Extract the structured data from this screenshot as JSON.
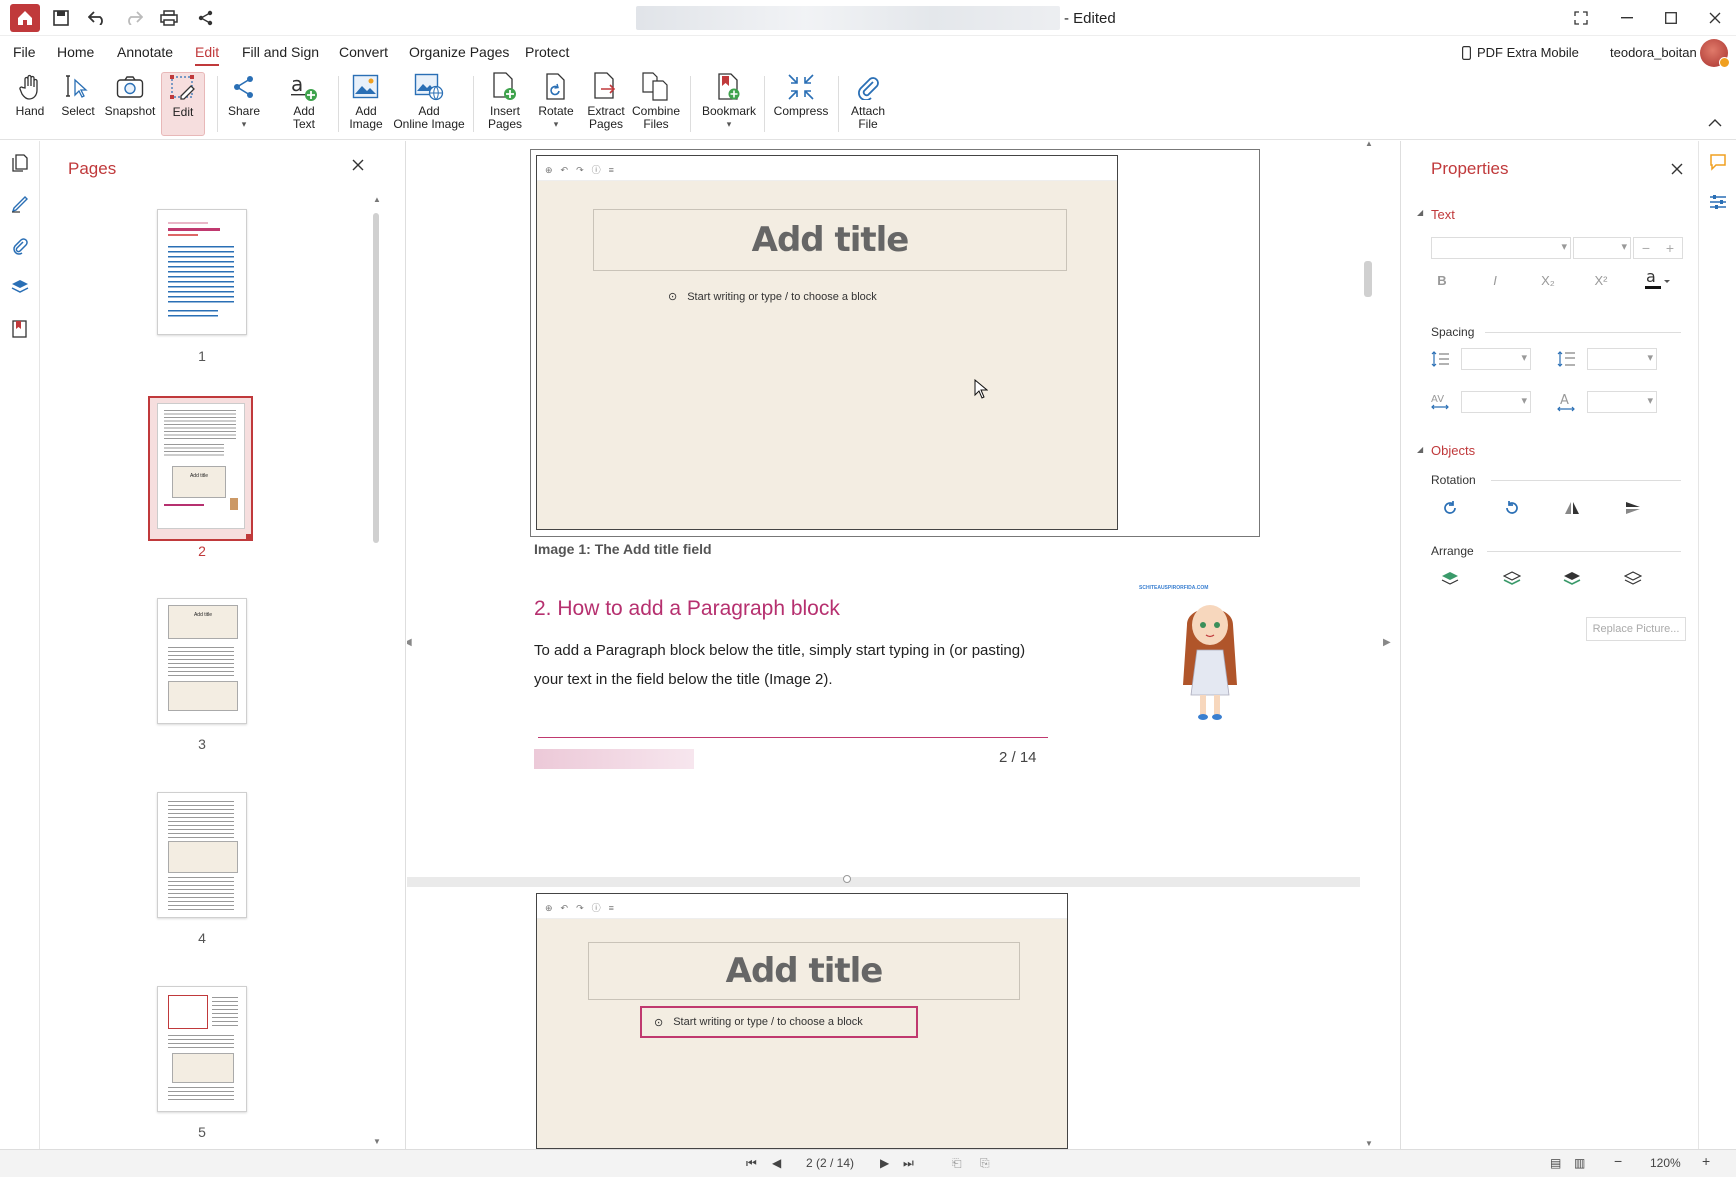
{
  "window": {
    "title_suffix": "- Edited",
    "user": "teodora_boitan",
    "mobile_label": "PDF Extra Mobile"
  },
  "menu": [
    "File",
    "Home",
    "Annotate",
    "Edit",
    "Fill and Sign",
    "Convert",
    "Organize Pages",
    "Protect"
  ],
  "ribbon": {
    "hand": "Hand",
    "select": "Select",
    "snapshot": "Snapshot",
    "edit": "Edit",
    "share": "Share",
    "add_text": "Add\nText",
    "add_image": "Add\nImage",
    "add_online_image": "Add\nOnline Image",
    "insert_pages": "Insert\nPages",
    "rotate": "Rotate",
    "extract_pages": "Extract\nPages",
    "combine_files": "Combine\nFiles",
    "bookmark": "Bookmark",
    "compress": "Compress",
    "attach_file": "Attach\nFile"
  },
  "pages_panel": {
    "title": "Pages",
    "pages": [
      "1",
      "2",
      "3",
      "4",
      "5"
    ],
    "selected": 2
  },
  "document": {
    "editor_title": "Add title",
    "block_hint": "Start writing or type / to choose a block",
    "caption": "Image 1: The Add title field",
    "heading": "2. How to add a Paragraph block",
    "para_line1": "To add a Paragraph block below the title, simply start typing in (or pasting)",
    "para_line2": "your text in the field below the title (Image 2).",
    "page_number": "2 / 14",
    "watermark": "SCHITEAUSPIRORFIDA.COM"
  },
  "properties": {
    "title": "Properties",
    "text_section": "Text",
    "spacing": "Spacing",
    "objects_section": "Objects",
    "rotation": "Rotation",
    "arrange": "Arrange",
    "replace_picture": "Replace Picture...",
    "bold": "B",
    "italic": "I",
    "subscript": "X₂",
    "superscript": "X²"
  },
  "status": {
    "page_indicator": "2 (2 / 14)",
    "zoom": "120%"
  },
  "colors": {
    "accent": "#c0393b",
    "heading": "#b6306f",
    "editor_bg": "#f3ede2"
  }
}
